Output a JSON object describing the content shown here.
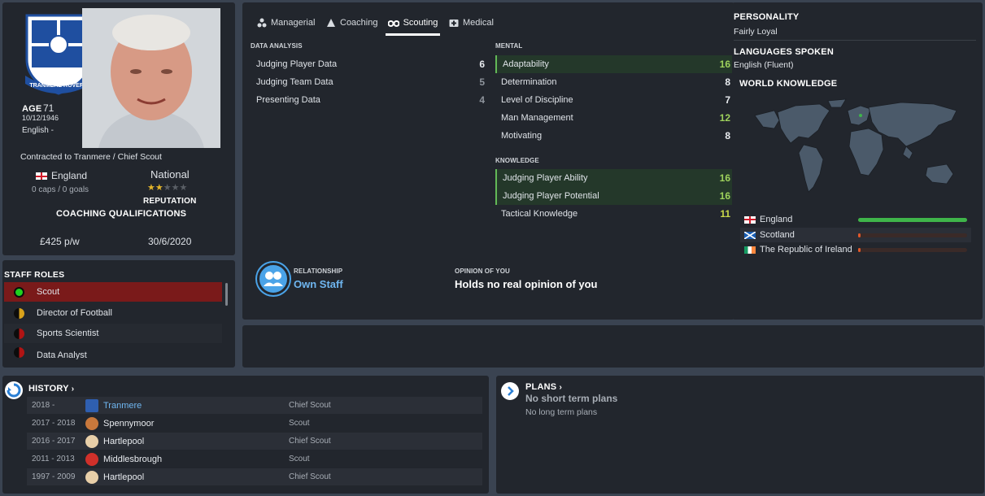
{
  "profile": {
    "age_label": "AGE",
    "age": "71",
    "dob": "10/12/1946",
    "nationality_line": "English -",
    "contract": "Contracted to Tranmere / Chief Scout",
    "nation": "England",
    "caps": "0 caps / 0 goals",
    "rep_level": "National",
    "rep_label": "REPUTATION",
    "rep_stars": 1.5,
    "coaching_quals": "COACHING QUALIFICATIONS",
    "wage": "£425 p/w",
    "contract_end": "30/6/2020"
  },
  "staff_roles": {
    "title": "STAFF ROLES",
    "items": [
      {
        "label": "Scout",
        "color": "#1fd11f",
        "selected": true
      },
      {
        "label": "Director of Football",
        "color": "#d9a21b",
        "selected": false
      },
      {
        "label": "Sports Scientist",
        "color": "#b01414",
        "selected": false
      },
      {
        "label": "Data Analyst",
        "color": "#b01414",
        "selected": false
      }
    ]
  },
  "tabs": [
    {
      "label": "Managerial",
      "icon": "managerial-icon"
    },
    {
      "label": "Coaching",
      "icon": "coaching-icon"
    },
    {
      "label": "Scouting",
      "icon": "binoculars-icon"
    },
    {
      "label": "Medical",
      "icon": "medical-icon"
    }
  ],
  "data_analysis": {
    "title": "DATA ANALYSIS",
    "items": [
      {
        "name": "Judging Player Data",
        "value": "6"
      },
      {
        "name": "Judging Team Data",
        "value": "5"
      },
      {
        "name": "Presenting Data",
        "value": "4"
      }
    ]
  },
  "mental": {
    "title": "MENTAL",
    "items": [
      {
        "name": "Adaptability",
        "value": "16",
        "highlight": true
      },
      {
        "name": "Determination",
        "value": "8",
        "highlight": false
      },
      {
        "name": "Level of Discipline",
        "value": "7",
        "highlight": false
      },
      {
        "name": "Man Management",
        "value": "12",
        "highlight": false
      },
      {
        "name": "Motivating",
        "value": "8",
        "highlight": false
      }
    ]
  },
  "knowledge": {
    "title": "KNOWLEDGE",
    "items": [
      {
        "name": "Judging Player Ability",
        "value": "16",
        "highlight": true
      },
      {
        "name": "Judging Player Potential",
        "value": "16",
        "highlight": true
      },
      {
        "name": "Tactical Knowledge",
        "value": "11",
        "highlight": false
      }
    ]
  },
  "relationship": {
    "label": "RELATIONSHIP",
    "value": "Own Staff",
    "opinion_label": "OPINION OF YOU",
    "opinion_value": "Holds no real opinion of you"
  },
  "personality": {
    "title": "PERSONALITY",
    "value": "Fairly Loyal",
    "lang_title": "LANGUAGES SPOKEN",
    "lang_value": "English (Fluent)",
    "world_title": "WORLD KNOWLEDGE"
  },
  "world_knowledge": [
    {
      "name": "England",
      "level": 1.0,
      "color": "#3fb54a"
    },
    {
      "name": "Scotland",
      "level": 0.02,
      "color": "#e0582a"
    },
    {
      "name": "The Republic of Ireland",
      "level": 0.02,
      "color": "#e0582a"
    }
  ],
  "history": {
    "title": "HISTORY",
    "rows": [
      {
        "years": "2018 -",
        "club": "Tranmere",
        "role": "Chief Scout",
        "link": true
      },
      {
        "years": "2017 - 2018",
        "club": "Spennymoor",
        "role": "Scout",
        "link": false
      },
      {
        "years": "2016 - 2017",
        "club": "Hartlepool",
        "role": "Chief Scout",
        "link": false
      },
      {
        "years": "2011 - 2013",
        "club": "Middlesbrough",
        "role": "Scout",
        "link": false
      },
      {
        "years": "1997 - 2009",
        "club": "Hartlepool",
        "role": "Chief Scout",
        "link": false
      }
    ]
  },
  "plans": {
    "title": "PLANS",
    "short": "No short term plans",
    "long": "No long term plans"
  },
  "colors": {
    "accent_green": "#9ed15c",
    "highlight_bg": "#24382a",
    "link_blue": "#6fb6f0",
    "role_selected": "#7a1a1a"
  }
}
